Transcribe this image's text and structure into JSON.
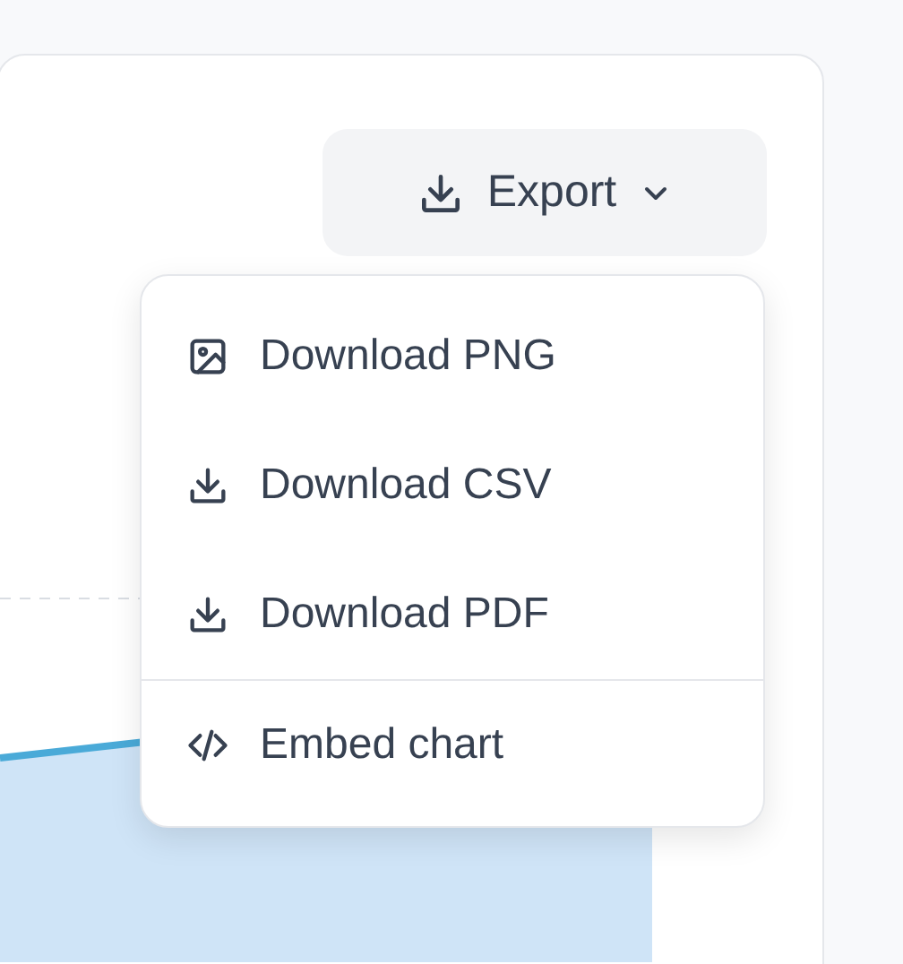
{
  "export_button": {
    "label": "Export"
  },
  "menu": {
    "items": [
      {
        "kind": "image",
        "label": "Download PNG",
        "divider_before": false
      },
      {
        "kind": "download",
        "label": "Download CSV",
        "divider_before": false
      },
      {
        "kind": "download",
        "label": "Download PDF",
        "divider_before": false
      },
      {
        "kind": "code",
        "label": "Embed chart",
        "divider_before": true
      }
    ]
  }
}
